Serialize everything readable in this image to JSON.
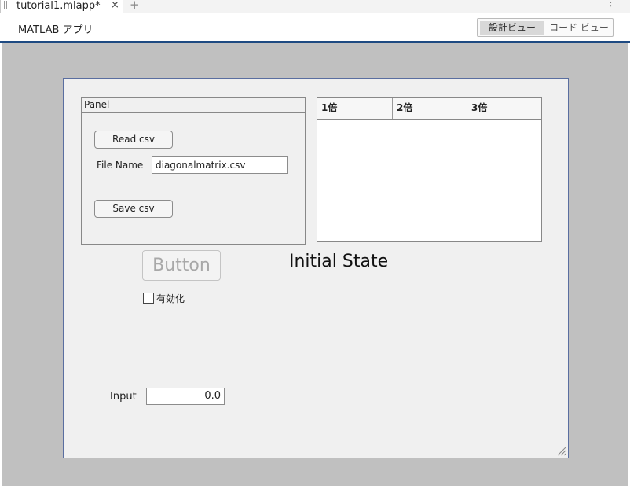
{
  "tab": {
    "title": "tutorial1.mlapp*",
    "close_glyph": "×",
    "add_glyph": "+"
  },
  "menu": {
    "kebab_glyph": "⋮"
  },
  "header": {
    "app_title": "MATLAB アプリ",
    "design_view": "設計ビュー",
    "code_view": "コード ビュー"
  },
  "panel": {
    "title": "Panel",
    "read_button": "Read csv",
    "file_name_label": "File Name",
    "file_name_value": "diagonalmatrix.csv",
    "save_button": "Save csv"
  },
  "table": {
    "columns": [
      "1倍",
      "2倍",
      "3倍"
    ],
    "rows": []
  },
  "button": {
    "label": "Button"
  },
  "state_label": "Initial State",
  "checkbox": {
    "label": "有効化",
    "checked": false
  },
  "input": {
    "label": "Input",
    "value": "0.0"
  },
  "colors": {
    "accent": "#1e4a82",
    "canvas": "#c0c0c0",
    "figure": "#f0f0f0",
    "border": "#5a6ea0"
  }
}
